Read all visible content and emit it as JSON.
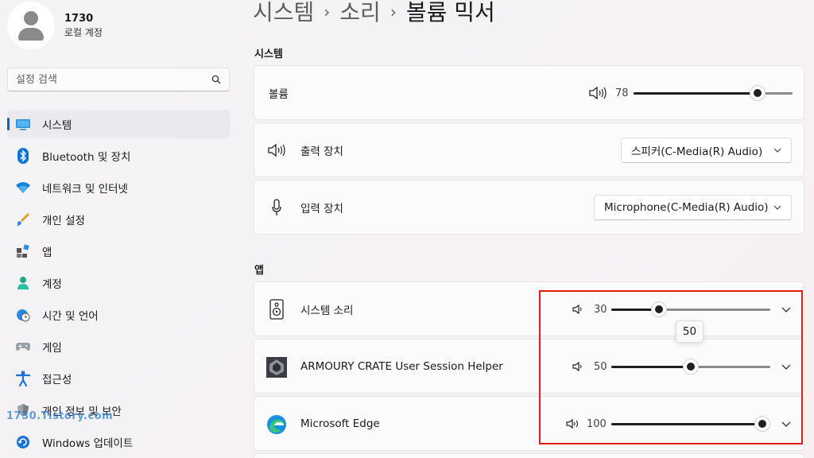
{
  "profile": {
    "name": "1730",
    "account_type": "로컬 계정"
  },
  "search": {
    "placeholder": "설정 검색"
  },
  "nav": {
    "items": [
      {
        "label": "시스템",
        "icon": "monitor-icon"
      },
      {
        "label": "Bluetooth 및 장치",
        "icon": "bluetooth-icon"
      },
      {
        "label": "네트워크 및 인터넷",
        "icon": "wifi-icon"
      },
      {
        "label": "개인 설정",
        "icon": "brush-icon"
      },
      {
        "label": "앱",
        "icon": "apps-icon"
      },
      {
        "label": "계정",
        "icon": "person-icon"
      },
      {
        "label": "시간 및 언어",
        "icon": "globe-clock-icon"
      },
      {
        "label": "게임",
        "icon": "gamepad-icon"
      },
      {
        "label": "접근성",
        "icon": "accessibility-icon"
      },
      {
        "label": "개인 정보 및 보안",
        "icon": "shield-icon"
      },
      {
        "label": "Windows 업데이트",
        "icon": "update-icon"
      }
    ]
  },
  "watermark": "1730.Tistory.com",
  "breadcrumb": {
    "part1": "시스템",
    "part2": "소리",
    "current": "볼륨 믹서",
    "separator": "›"
  },
  "system_section": {
    "title": "시스템",
    "volume": {
      "label": "볼륨",
      "value": 78
    },
    "output": {
      "label": "출력 장치",
      "selected": "스피커(C-Media(R) Audio)"
    },
    "input": {
      "label": "입력 장치",
      "selected": "Microphone(C-Media(R) Audio)"
    }
  },
  "apps_section": {
    "title": "앱",
    "apps": [
      {
        "name": "시스템 소리",
        "volume": 30,
        "icon": "speaker-box-icon"
      },
      {
        "name": "ARMOURY CRATE User Session Helper",
        "volume": 50,
        "icon": "armoury-crate-icon"
      },
      {
        "name": "Microsoft Edge",
        "volume": 100,
        "icon": "edge-icon"
      }
    ]
  },
  "tooltip": {
    "value": "50"
  },
  "colors": {
    "accent": "#0067c0",
    "highlight_box": "#e11919"
  }
}
